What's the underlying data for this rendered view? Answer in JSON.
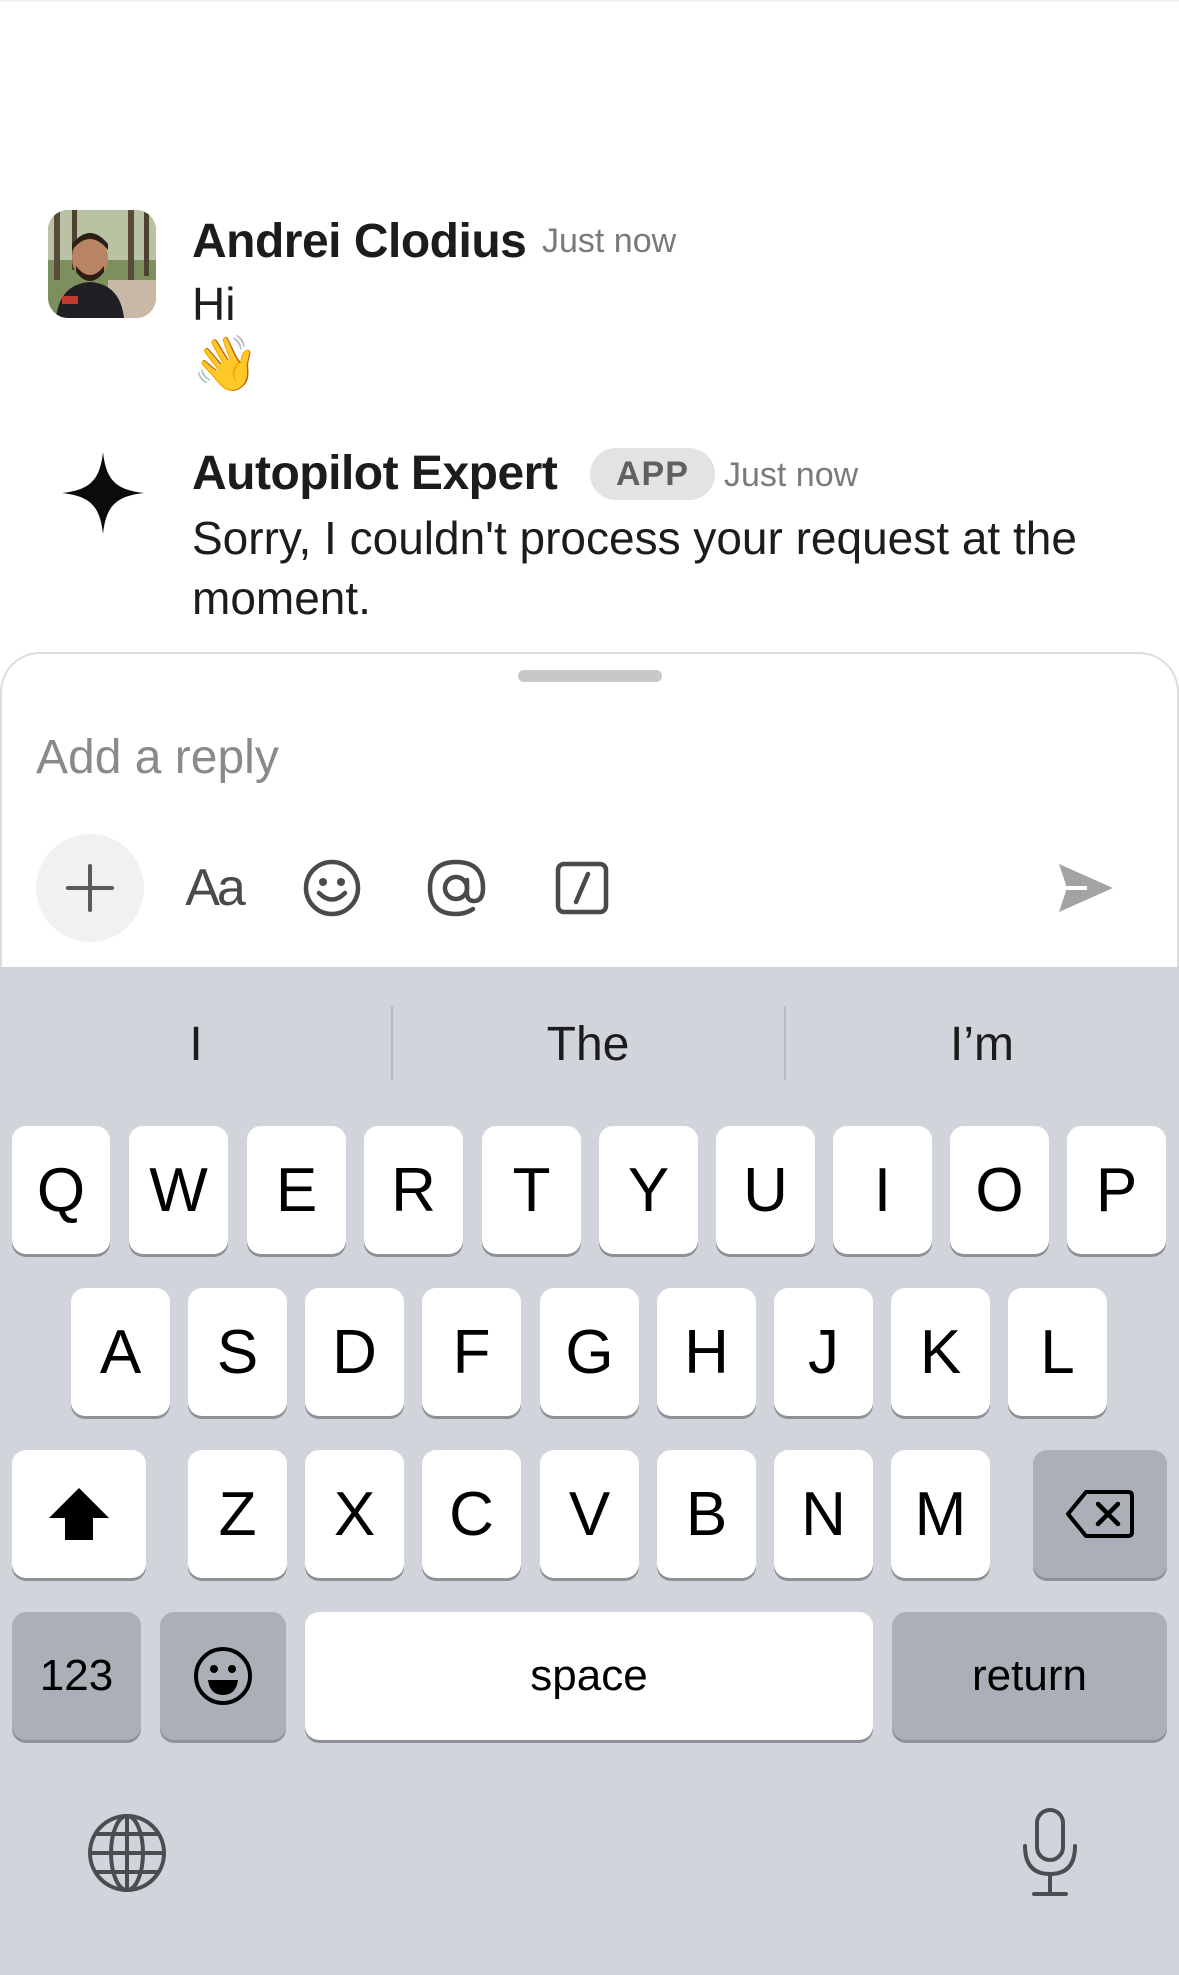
{
  "messages": [
    {
      "sender": "Andrei Clodius",
      "time": "Just now",
      "text": "Hi",
      "emoji": "👋"
    },
    {
      "sender": "Autopilot Expert",
      "badge": "APP",
      "time": "Just now",
      "text": "Sorry, I couldn't process your request at the moment."
    }
  ],
  "composer": {
    "placeholder": "Add a reply",
    "format_label": "Aa"
  },
  "keyboard": {
    "suggestions": [
      "I",
      "The",
      "I’m"
    ],
    "row1": [
      "Q",
      "W",
      "E",
      "R",
      "T",
      "Y",
      "U",
      "I",
      "O",
      "P"
    ],
    "row2": [
      "A",
      "S",
      "D",
      "F",
      "G",
      "H",
      "J",
      "K",
      "L"
    ],
    "row3": [
      "Z",
      "X",
      "C",
      "V",
      "B",
      "N",
      "M"
    ],
    "numbers_label": "123",
    "space_label": "space",
    "return_label": "return"
  }
}
